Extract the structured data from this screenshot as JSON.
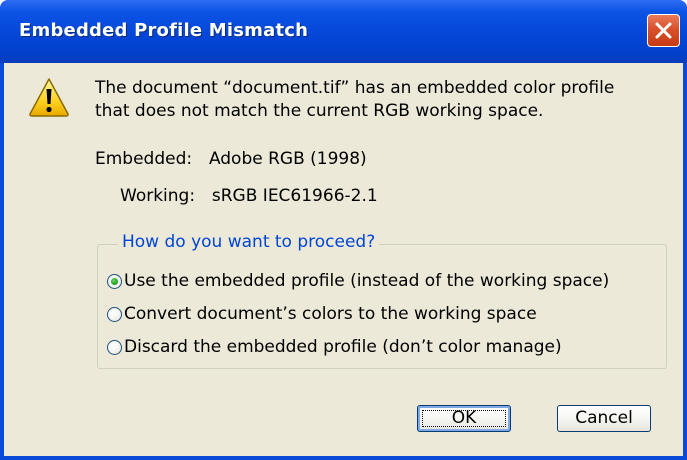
{
  "window": {
    "title": "Embedded Profile Mismatch",
    "close_icon": "close-icon"
  },
  "message": {
    "icon": "warning-icon",
    "line1": "The document “document.tif” has an embedded color profile",
    "line2": "that does not match the current RGB working space."
  },
  "profiles": {
    "embedded_label": "Embedded:",
    "embedded_value": "Adobe RGB (1998)",
    "working_label": "Working:",
    "working_value": "sRGB IEC61966-2.1"
  },
  "options": {
    "legend": "How do you want to proceed?",
    "items": [
      {
        "label": "Use the embedded profile (instead of the working space)",
        "selected": true
      },
      {
        "label": "Convert document’s colors to the working space",
        "selected": false
      },
      {
        "label": "Discard the embedded profile (don’t color manage)",
        "selected": false
      }
    ]
  },
  "buttons": {
    "ok": "OK",
    "cancel": "Cancel"
  },
  "colors": {
    "titlebar": "#0546d8",
    "dialog_bg": "#ece9d8",
    "legend_text": "#0046d5",
    "close_button": "#d9512a"
  }
}
